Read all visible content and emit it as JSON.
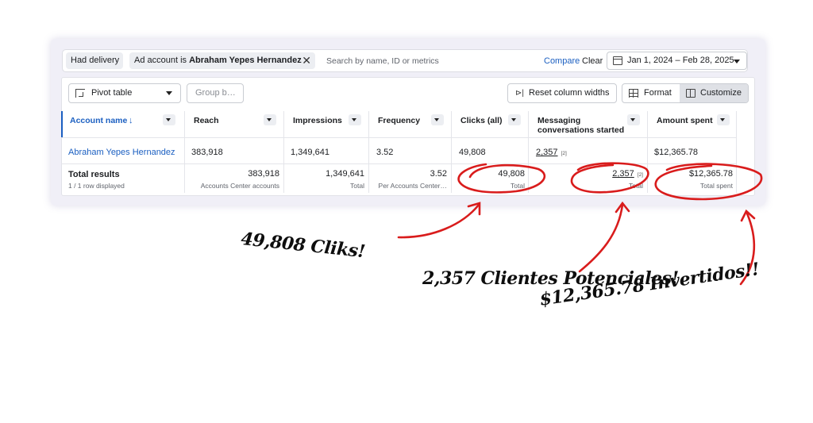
{
  "filters": {
    "had_delivery": "Had delivery",
    "account_prefix": "Ad account is ",
    "account_name": "Abraham Yepes Hernandez",
    "search_placeholder": "Search by name, ID or metrics",
    "compare": "Compare",
    "clear": "Clear",
    "date_range": "Jan 1, 2024 – Feb 28, 2025"
  },
  "toolbar": {
    "pivot": "Pivot table",
    "group_placeholder": "Group b…",
    "reset": "Reset column widths",
    "format": "Format",
    "customize": "Customize"
  },
  "columns": {
    "account": "Account name",
    "sort": "↓",
    "reach": "Reach",
    "impressions": "Impressions",
    "frequency": "Frequency",
    "clicks": "Clicks (all)",
    "messaging_1": "Messaging",
    "messaging_2": "conversations started",
    "amount": "Amount spent"
  },
  "row": {
    "account": "Abraham Yepes Hernandez",
    "reach": "383,918",
    "impressions": "1,349,641",
    "frequency": "3.52",
    "clicks": "49,808",
    "messaging": "2,357",
    "messaging_note": "[2]",
    "amount": "$12,365.78"
  },
  "totals": {
    "label": "Total results",
    "rows_displayed": "1 / 1 row displayed",
    "reach": "383,918",
    "reach_sub": "Accounts Center accounts",
    "impressions": "1,349,641",
    "impressions_sub": "Total",
    "frequency": "3.52",
    "frequency_sub": "Per Accounts Center…",
    "clicks": "49,808",
    "clicks_sub": "Total",
    "messaging": "2,357",
    "messaging_note": "[2]",
    "messaging_sub": "Total",
    "amount": "$12,365.78",
    "amount_sub": "Total spent"
  },
  "annotations": {
    "clicks": "49,808 Cliks!",
    "leads": "2,357 Clientes Potenciales!",
    "invested": "$12,365.78  Invertidos!!"
  },
  "colors": {
    "accent": "#1b5fc1",
    "ink": "#d91c1c"
  }
}
